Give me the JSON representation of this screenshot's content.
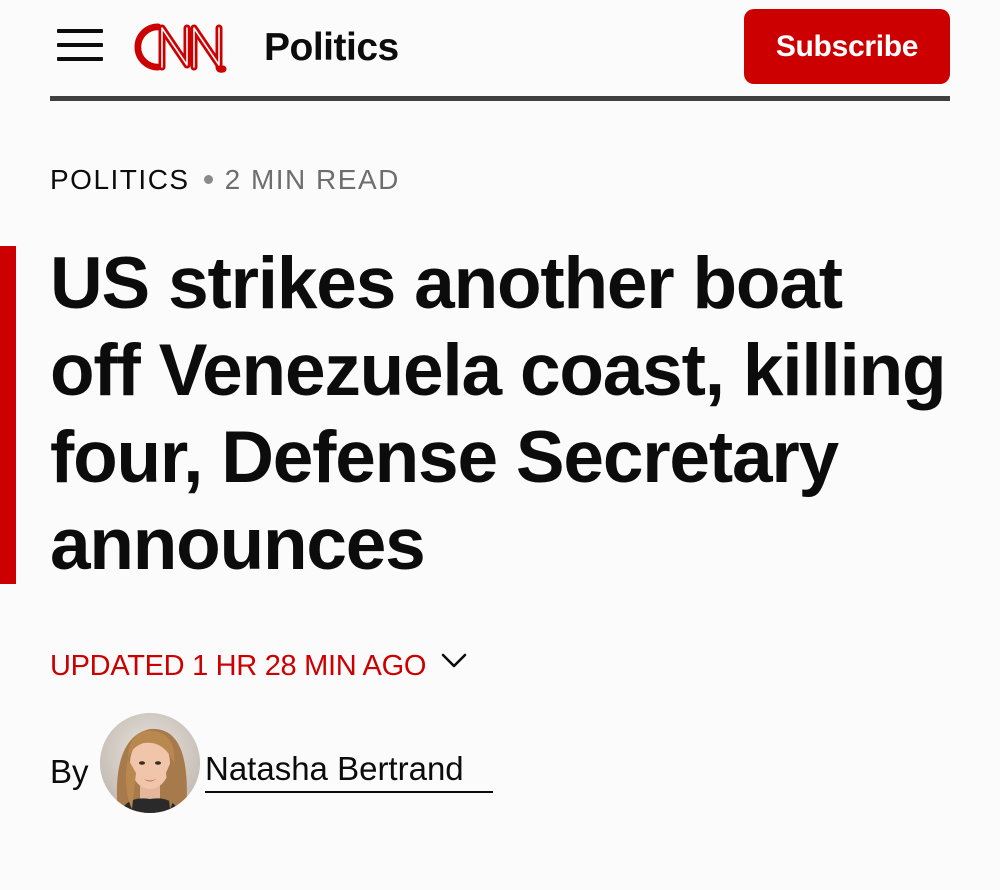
{
  "header": {
    "menu_icon": "hamburger-menu-icon",
    "logo_text": "CNN",
    "section_title": "Politics",
    "subscribe_label": "Subscribe",
    "brand_color": "#cc0000"
  },
  "article": {
    "section": "POLITICS",
    "read_time": "2 MIN READ",
    "headline": "US strikes another boat off Venezuela coast, killing four, Defense Secretary announces",
    "updated": "UPDATED 1 HR 28 MIN AGO",
    "updated_toggle_icon": "chevron-down-icon",
    "byline_prefix": "By",
    "author_name": "Natasha Bertrand",
    "author_avatar": "author-avatar-photo"
  }
}
